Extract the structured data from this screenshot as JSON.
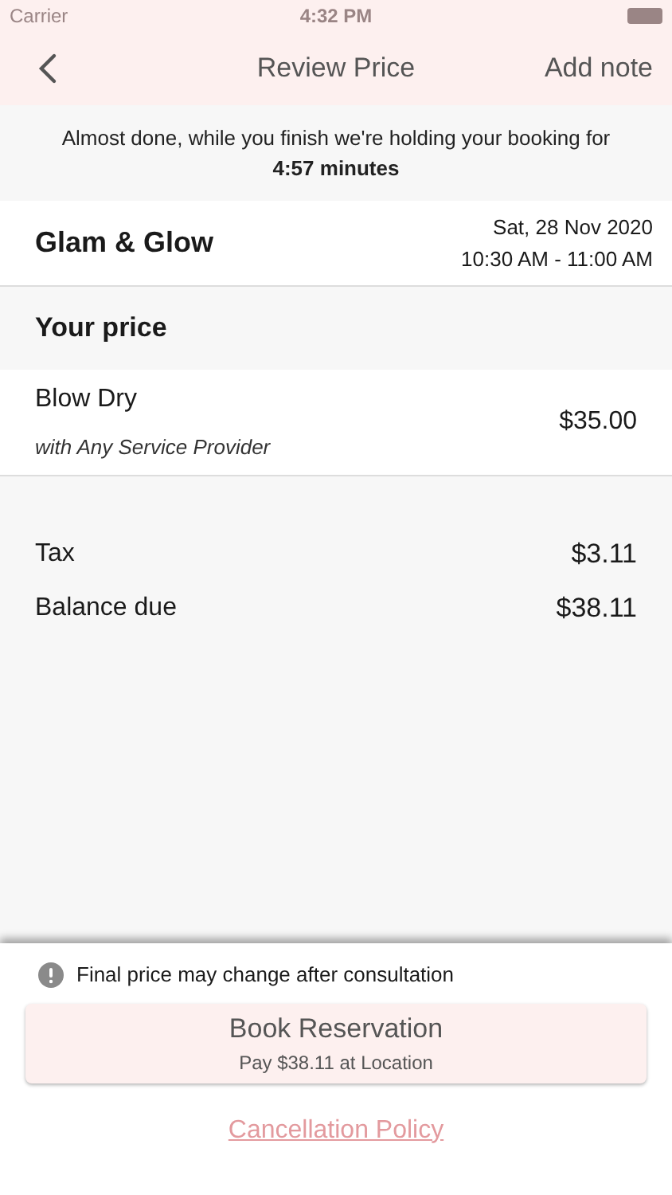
{
  "status_bar": {
    "carrier": "Carrier",
    "time": "4:32 PM"
  },
  "nav": {
    "title": "Review Price",
    "action": "Add note"
  },
  "banner": {
    "message": "Almost done, while you finish we're holding your booking for",
    "timer": "4:57 minutes"
  },
  "salon": {
    "name": "Glam & Glow",
    "date": "Sat, 28 Nov 2020",
    "time": "10:30 AM - 11:00 AM"
  },
  "section_title": "Your price",
  "services": [
    {
      "name": "Blow Dry",
      "provider": "with Any Service Provider",
      "price": "$35.00"
    }
  ],
  "totals": [
    {
      "label": "Tax",
      "amount": "$3.11"
    },
    {
      "label": "Balance due",
      "amount": "$38.11"
    }
  ],
  "notice": "Final price may change after consultation",
  "book_button": {
    "label": "Book Reservation",
    "sublabel": "Pay $38.11 at Location"
  },
  "policy_link": "Cancellation Policy"
}
